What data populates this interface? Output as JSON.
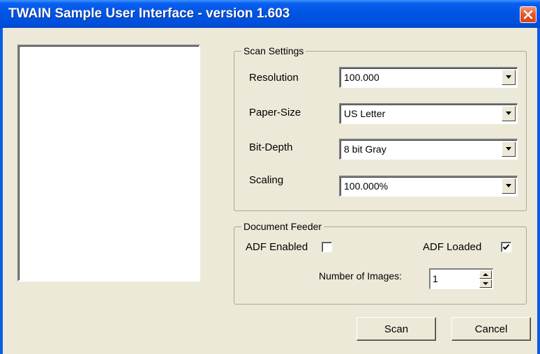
{
  "window": {
    "title": "TWAIN Sample User Interface - version 1.603"
  },
  "scan_settings": {
    "group_title": "Scan Settings",
    "resolution": {
      "label": "Resolution",
      "value": "100.000"
    },
    "paper_size": {
      "label": "Paper-Size",
      "value": "US Letter"
    },
    "bit_depth": {
      "label": "Bit-Depth",
      "value": "8 bit Gray"
    },
    "scaling": {
      "label": "Scaling",
      "value": "100.000%"
    }
  },
  "document_feeder": {
    "group_title": "Document Feeder",
    "adf_enabled": {
      "label": "ADF Enabled",
      "checked": false
    },
    "adf_loaded": {
      "label": "ADF Loaded",
      "checked": true
    },
    "number_of_images": {
      "label": "Number of Images:",
      "value": "1"
    }
  },
  "buttons": {
    "scan": "Scan",
    "cancel": "Cancel"
  },
  "icons": {
    "close": "close-icon",
    "dropdown": "chevron-down-icon",
    "spin_up": "spin-up-icon",
    "spin_down": "spin-down-icon",
    "check": "checkmark-icon"
  }
}
